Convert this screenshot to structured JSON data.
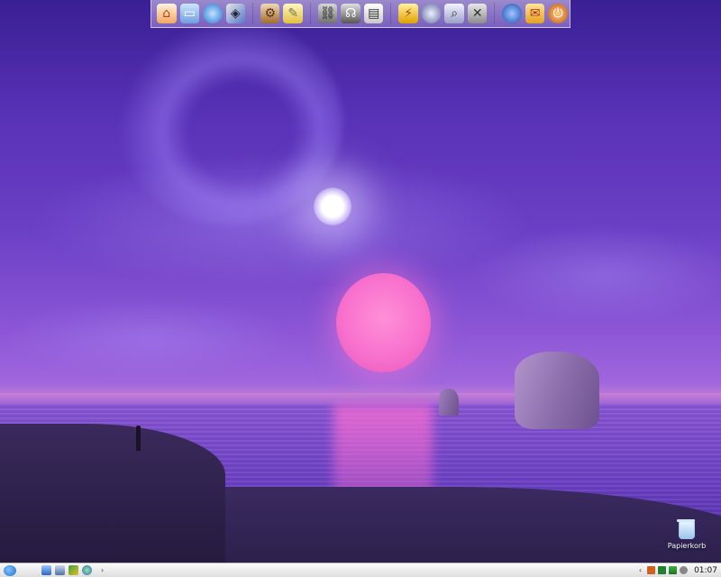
{
  "desktop": {
    "icons": [
      {
        "name": "trash",
        "label": "Papierkorb"
      }
    ]
  },
  "dock": {
    "groups": [
      [
        "home-icon",
        "folder-icon",
        "globe-icon",
        "shield-icon"
      ],
      [
        "settings-icon",
        "notepad-icon"
      ],
      [
        "network-icon",
        "search-person-icon",
        "presentation-icon"
      ],
      [
        "lightning-icon",
        "disk-icon",
        "magnifier-icon",
        "tools-icon"
      ],
      [
        "planet-icon",
        "mail-icon",
        "power-icon"
      ]
    ]
  },
  "taskbar": {
    "clock": "01:07",
    "quick_launch": [
      "desktop-icon",
      "window-icon",
      "puzzle-icon",
      "globe-icon"
    ],
    "tray": [
      "cat-icon",
      "green-square-icon",
      "arrows-icon",
      "shield-tray-icon"
    ]
  }
}
